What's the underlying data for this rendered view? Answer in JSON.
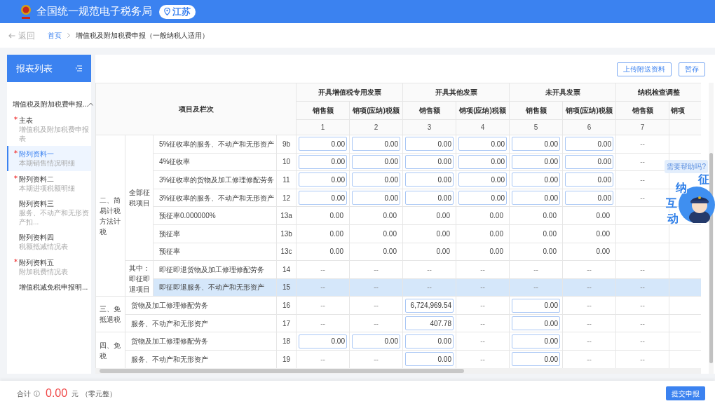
{
  "header": {
    "title": "全国统一规范电子税务局",
    "region": "江苏"
  },
  "nav": {
    "back": "返回",
    "breadcrumb": [
      {
        "label": "首页",
        "link": true
      },
      {
        "label": "增值税及附加税费申报（一般纳税人适用）",
        "link": false
      }
    ]
  },
  "sidebar": {
    "title": "报表列表",
    "group": {
      "label": "增值税及附加税费申报...",
      "expanded": true
    },
    "items": [
      {
        "title": "主表",
        "subtitle": "增值税及附加税费申报表",
        "required": true,
        "selected": false
      },
      {
        "title": "附列资料一",
        "subtitle": "本期销售情况明细",
        "required": true,
        "selected": true
      },
      {
        "title": "附列资料二",
        "subtitle": "本期进项税额明细",
        "required": true,
        "selected": false
      },
      {
        "title": "附列资料三",
        "subtitle": "服务、不动产和无形资产扣...",
        "required": false,
        "selected": false
      },
      {
        "title": "附列资料四",
        "subtitle": "税额抵减情况表",
        "required": false,
        "selected": false
      },
      {
        "title": "附列资料五",
        "subtitle": "附加税费情况表",
        "required": true,
        "selected": false
      },
      {
        "title": "增值税减免税申报明...",
        "required": false,
        "selected": false
      }
    ]
  },
  "toolbar": {
    "buttons": [
      "上传附送资料",
      "暂存"
    ]
  },
  "table": {
    "corner": "项目及栏次",
    "groups": [
      {
        "label": "开具增值税专用发票",
        "columns": [
          {
            "label": "销售额",
            "number": "1"
          },
          {
            "label": "销项(应纳)税额",
            "number": "2"
          }
        ]
      },
      {
        "label": "开具其他发票",
        "columns": [
          {
            "label": "销售额",
            "number": "3"
          },
          {
            "label": "销项(应纳)税额",
            "number": "4"
          }
        ]
      },
      {
        "label": "未开具发票",
        "columns": [
          {
            "label": "销售额",
            "number": "5"
          },
          {
            "label": "销项(应纳)税额",
            "number": "6"
          }
        ]
      },
      {
        "label": "纳税检查调整",
        "columns": [
          {
            "label": "销售额",
            "number": "7"
          },
          {
            "label": "销项"
          }
        ]
      }
    ],
    "sections": [
      {
        "label": "二、简易计税方法计税",
        "subsections": [
          {
            "label": "全部征税项目",
            "rows": [
              {
                "item": "5%征收率的服务、不动产和无形资产",
                "line": "9b",
                "selected": false,
                "cells": [
                  {
                    "kind": "input",
                    "value": "0.00"
                  },
                  {
                    "kind": "input",
                    "value": "0.00"
                  },
                  {
                    "kind": "input",
                    "value": "0.00"
                  },
                  {
                    "kind": "input",
                    "value": "0.00"
                  },
                  {
                    "kind": "input",
                    "value": "0.00"
                  },
                  {
                    "kind": "input",
                    "value": "0.00"
                  },
                  {
                    "kind": "text",
                    "value": "--"
                  }
                ]
              },
              {
                "item": "4%征收率",
                "line": "10",
                "selected": false,
                "cells": [
                  {
                    "kind": "input",
                    "value": "0.00"
                  },
                  {
                    "kind": "input",
                    "value": "0.00"
                  },
                  {
                    "kind": "input",
                    "value": "0.00"
                  },
                  {
                    "kind": "input",
                    "value": "0.00"
                  },
                  {
                    "kind": "input",
                    "value": "0.00"
                  },
                  {
                    "kind": "input",
                    "value": "0.00"
                  },
                  {
                    "kind": "text",
                    "value": "--"
                  }
                ]
              },
              {
                "item": "3%征收率的货物及加工修理修配劳务",
                "line": "11",
                "selected": false,
                "cells": [
                  {
                    "kind": "input",
                    "value": "0.00"
                  },
                  {
                    "kind": "input",
                    "value": "0.00"
                  },
                  {
                    "kind": "input",
                    "value": "0.00"
                  },
                  {
                    "kind": "input",
                    "value": "0.00"
                  },
                  {
                    "kind": "input",
                    "value": "0.00"
                  },
                  {
                    "kind": "input",
                    "value": "0.00"
                  },
                  {
                    "kind": "text",
                    "value": "--"
                  }
                ]
              },
              {
                "item": "3%征收率的服务、不动产和无形资产",
                "line": "12",
                "selected": false,
                "cells": [
                  {
                    "kind": "input",
                    "value": "0.00"
                  },
                  {
                    "kind": "input",
                    "value": "0.00"
                  },
                  {
                    "kind": "input",
                    "value": "0.00"
                  },
                  {
                    "kind": "input",
                    "value": "0.00"
                  },
                  {
                    "kind": "input",
                    "value": "0.00"
                  },
                  {
                    "kind": "input",
                    "value": "0.00"
                  },
                  {
                    "kind": "text",
                    "value": "--"
                  }
                ]
              },
              {
                "item": "预征率0.000000%",
                "line": "13a",
                "selected": false,
                "cells": [
                  {
                    "kind": "text",
                    "value": "0.00"
                  },
                  {
                    "kind": "text",
                    "value": "0.00"
                  },
                  {
                    "kind": "text",
                    "value": "0.00"
                  },
                  {
                    "kind": "text",
                    "value": "0.00"
                  },
                  {
                    "kind": "text",
                    "value": "0.00"
                  },
                  {
                    "kind": "text",
                    "value": "0.00"
                  },
                  {
                    "kind": "empty"
                  }
                ]
              },
              {
                "item": "预征率",
                "line": "13b",
                "selected": false,
                "cells": [
                  {
                    "kind": "text",
                    "value": "0.00"
                  },
                  {
                    "kind": "text",
                    "value": "0.00"
                  },
                  {
                    "kind": "text",
                    "value": "0.00"
                  },
                  {
                    "kind": "text",
                    "value": "0.00"
                  },
                  {
                    "kind": "text",
                    "value": "0.00"
                  },
                  {
                    "kind": "text",
                    "value": "0.00"
                  },
                  {
                    "kind": "empty"
                  }
                ]
              },
              {
                "item": "预征率",
                "line": "13c",
                "selected": false,
                "cells": [
                  {
                    "kind": "text",
                    "value": "0.00"
                  },
                  {
                    "kind": "text",
                    "value": "0.00"
                  },
                  {
                    "kind": "text",
                    "value": "0.00"
                  },
                  {
                    "kind": "text",
                    "value": "0.00"
                  },
                  {
                    "kind": "text",
                    "value": "0.00"
                  },
                  {
                    "kind": "text",
                    "value": "0.00"
                  },
                  {
                    "kind": "empty"
                  }
                ]
              }
            ]
          },
          {
            "label": "其中：即征即退项目",
            "rows": [
              {
                "item": "即征即退货物及加工修理修配劳务",
                "line": "14",
                "selected": false,
                "cells": [
                  {
                    "kind": "text",
                    "value": "--"
                  },
                  {
                    "kind": "text",
                    "value": "--"
                  },
                  {
                    "kind": "text",
                    "value": "--"
                  },
                  {
                    "kind": "text",
                    "value": "--"
                  },
                  {
                    "kind": "text",
                    "value": "--"
                  },
                  {
                    "kind": "text",
                    "value": "--"
                  },
                  {
                    "kind": "text",
                    "value": "--"
                  }
                ]
              },
              {
                "item": "即征即退服务、不动产和无形资产",
                "line": "15",
                "selected": true,
                "cells": [
                  {
                    "kind": "text",
                    "value": "--"
                  },
                  {
                    "kind": "text",
                    "value": "--"
                  },
                  {
                    "kind": "text",
                    "value": "--"
                  },
                  {
                    "kind": "text",
                    "value": "--"
                  },
                  {
                    "kind": "text",
                    "value": "--"
                  },
                  {
                    "kind": "text",
                    "value": "--"
                  },
                  {
                    "kind": "text",
                    "value": "--"
                  }
                ]
              }
            ]
          }
        ]
      },
      {
        "label": "三、免抵退税",
        "rows": [
          {
            "item": "货物及加工修理修配劳务",
            "line": "16",
            "selected": false,
            "cells": [
              {
                "kind": "text",
                "value": "--"
              },
              {
                "kind": "text",
                "value": "--"
              },
              {
                "kind": "input",
                "value": "6,724,969.54"
              },
              {
                "kind": "text",
                "value": "--"
              },
              {
                "kind": "input",
                "value": "0.00"
              },
              {
                "kind": "text",
                "value": "--"
              },
              {
                "kind": "text",
                "value": "--"
              }
            ]
          },
          {
            "item": "服务、不动产和无形资产",
            "line": "17",
            "selected": false,
            "cells": [
              {
                "kind": "text",
                "value": "--"
              },
              {
                "kind": "text",
                "value": "--"
              },
              {
                "kind": "input",
                "value": "407.78"
              },
              {
                "kind": "text",
                "value": "--"
              },
              {
                "kind": "input",
                "value": "0.00"
              },
              {
                "kind": "text",
                "value": "--"
              },
              {
                "kind": "text",
                "value": "--"
              }
            ]
          }
        ]
      },
      {
        "label": "四、免税",
        "rows": [
          {
            "item": "货物及加工修理修配劳务",
            "line": "18",
            "selected": false,
            "cells": [
              {
                "kind": "input",
                "value": "0.00"
              },
              {
                "kind": "input",
                "value": "0.00"
              },
              {
                "kind": "input",
                "value": "0.00"
              },
              {
                "kind": "text",
                "value": "--"
              },
              {
                "kind": "input",
                "value": "0.00"
              },
              {
                "kind": "text",
                "value": "--"
              },
              {
                "kind": "text",
                "value": "--"
              }
            ]
          },
          {
            "item": "服务、不动产和无形资产",
            "line": "19",
            "selected": false,
            "cells": [
              {
                "kind": "text",
                "value": "--"
              },
              {
                "kind": "text",
                "value": "--"
              },
              {
                "kind": "input",
                "value": "0.00"
              },
              {
                "kind": "text",
                "value": "--"
              },
              {
                "kind": "input",
                "value": "0.00"
              },
              {
                "kind": "text",
                "value": "--"
              },
              {
                "kind": "text",
                "value": "--"
              }
            ]
          }
        ]
      }
    ]
  },
  "footer": {
    "label": "合计",
    "amount": "0.00",
    "unit": "元",
    "words": "（零元整）",
    "submit": "提交申报"
  },
  "helper": {
    "bubble": "需要帮助吗?",
    "chars": [
      "征",
      "纳",
      "互",
      "动"
    ]
  }
}
